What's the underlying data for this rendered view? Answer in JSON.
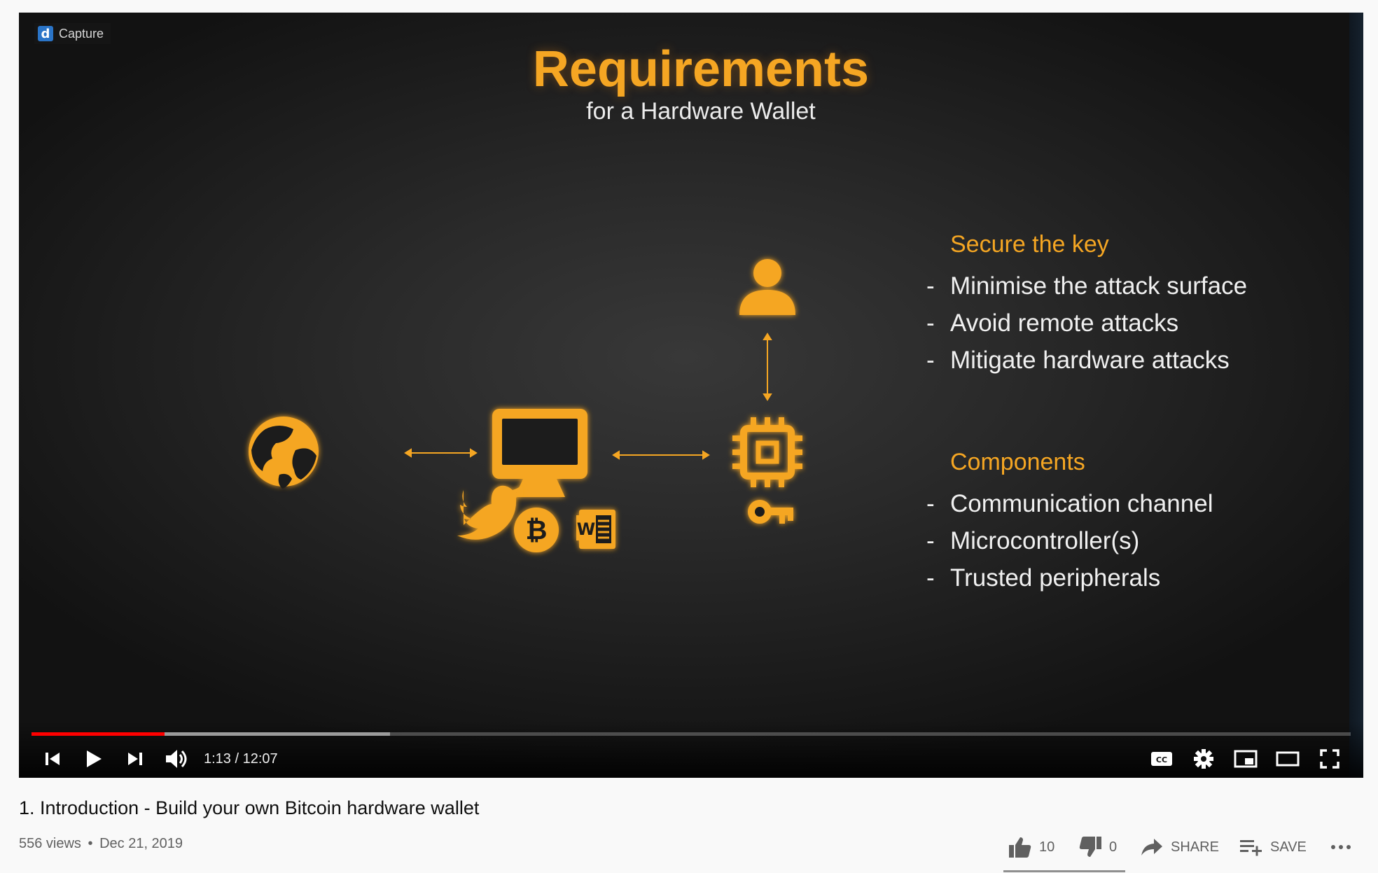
{
  "player": {
    "capture_label": "Capture",
    "slide": {
      "title": "Requirements",
      "subtitle": "for a Hardware Wallet",
      "sections": [
        {
          "heading": "Secure the key",
          "items": [
            "Minimise the attack surface",
            "Avoid remote attacks",
            "Mitigate hardware attacks"
          ]
        },
        {
          "heading": "Components",
          "items": [
            "Communication channel",
            "Microcontroller(s)",
            "Trusted peripherals"
          ]
        }
      ],
      "bullet_dash": "-",
      "diagram_icons": [
        "globe-icon",
        "monitor-icon",
        "twitter-icon",
        "bitcoin-icon",
        "word-icon",
        "user-icon",
        "chip-icon",
        "key-icon"
      ],
      "accent_color": "#f5a623"
    },
    "progress": {
      "played_fraction": 0.101,
      "buffered_fraction": 0.272
    },
    "time_display": "1:13 / 12:07",
    "controls": {
      "left": [
        "previous-icon",
        "play-icon",
        "next-icon",
        "volume-icon"
      ],
      "right": [
        "captions-icon",
        "settings-icon",
        "miniplayer-icon",
        "theater-icon",
        "fullscreen-icon"
      ]
    }
  },
  "video": {
    "title": "1. Introduction - Build your own Bitcoin hardware wallet",
    "views": "556 views",
    "separator": "•",
    "date": "Dec 21, 2019"
  },
  "actions": {
    "likes": "10",
    "dislikes": "0",
    "share_label": "SHARE",
    "save_label": "SAVE",
    "like_ratio": 1.0
  }
}
